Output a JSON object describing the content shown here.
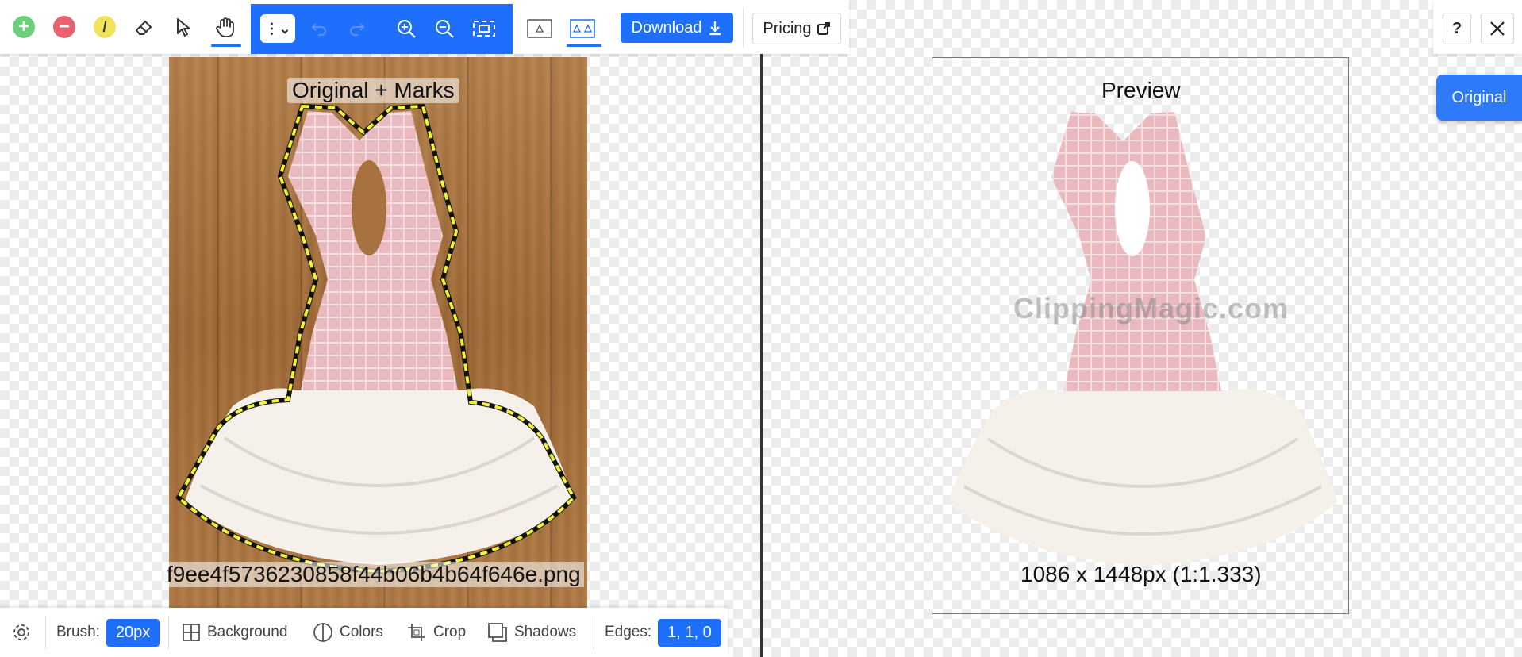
{
  "toolbar": {
    "tools": [
      {
        "name": "keep-tool",
        "icon": "plus-circle-icon",
        "color": "#6ccf7a"
      },
      {
        "name": "remove-tool",
        "icon": "minus-circle-icon",
        "color": "#e8616e"
      },
      {
        "name": "hair-tool",
        "icon": "pencil-icon",
        "color": "#f2e35c"
      },
      {
        "name": "eraser-tool",
        "icon": "eraser-icon"
      },
      {
        "name": "select-tool",
        "icon": "cursor-icon"
      },
      {
        "name": "pan-tool",
        "icon": "hand-icon",
        "selected": true
      }
    ],
    "group_icons": [
      "more-icon",
      "undo-icon",
      "redo-icon",
      "zoom-in-icon",
      "zoom-out-icon",
      "fit-icon"
    ],
    "view_icons": [
      "single-view-icon",
      "split-view-icon"
    ],
    "download_label": "Download",
    "pricing_label": "Pricing",
    "accent": "#1e6ffb"
  },
  "corner": {
    "help_label": "?",
    "original_label": "Original"
  },
  "left_panel": {
    "title": "Original + Marks",
    "filename": "f9ee4f5736230858f44b06b4b64f646e.png"
  },
  "right_panel": {
    "title": "Preview",
    "watermark": "ClippingMagic.com",
    "dimensions": "1086 x 1448px (1:1.333)"
  },
  "bottom_bar": {
    "brush_label": "Brush:",
    "brush_value": "20px",
    "background_label": "Background",
    "colors_label": "Colors",
    "crop_label": "Crop",
    "shadows_label": "Shadows",
    "edges_label": "Edges:",
    "edges_value": "1, 1, 0"
  }
}
